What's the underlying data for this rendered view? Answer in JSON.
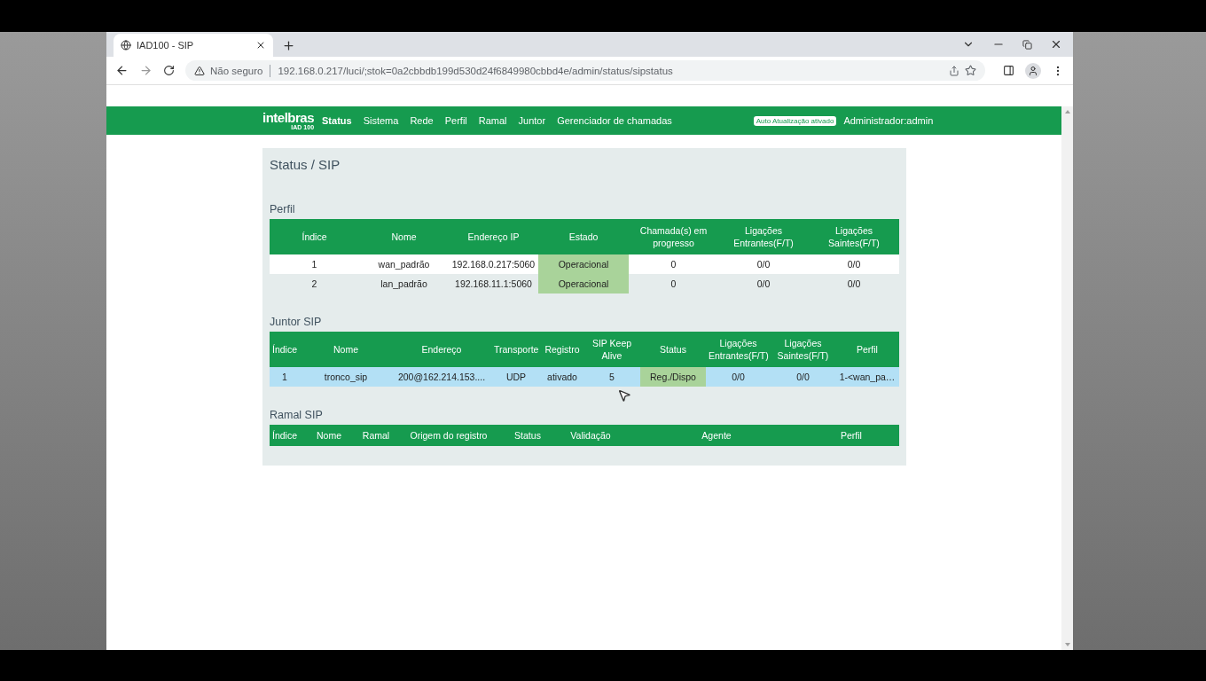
{
  "browser": {
    "tab": {
      "title": "IAD100 - SIP"
    },
    "address": {
      "security": "Não seguro",
      "url": "192.168.0.217/luci/;stok=0a2cbbdb199d530d24f6849980cbbd4e/admin/status/sipstatus"
    }
  },
  "nav": {
    "logo": "intelbras",
    "logo_sub": "IAD 100",
    "items": [
      {
        "label": "Status",
        "selected": true
      },
      {
        "label": "Sistema",
        "selected": false
      },
      {
        "label": "Rede",
        "selected": false
      },
      {
        "label": "Perfil",
        "selected": false
      },
      {
        "label": "Ramal",
        "selected": false
      },
      {
        "label": "Juntor",
        "selected": false
      },
      {
        "label": "Gerenciador de chamadas",
        "selected": false
      }
    ],
    "auto_update": "Auto Atualização ativado",
    "user": "Administrador:admin"
  },
  "page": {
    "title": "Status / SIP",
    "sections": [
      {
        "title": "Perfil",
        "columns": [
          {
            "label": "Índice",
            "kind": "text"
          },
          {
            "label": "Nome",
            "kind": "text"
          },
          {
            "label": "Endereço IP",
            "kind": "text"
          },
          {
            "label": "Estado",
            "kind": "status"
          },
          {
            "label": "Chamada(s) em progresso",
            "kind": "text"
          },
          {
            "label": "Ligações Entrantes(F/T)",
            "kind": "text"
          },
          {
            "label": "Ligações Saintes(F/T)",
            "kind": "text"
          }
        ],
        "rows": [
          {
            "cells": [
              "1",
              "wan_padrão",
              "192.168.0.217:5060",
              "Operacional",
              "0",
              "0/0",
              "0/0"
            ],
            "status_ok": true,
            "hovered": false
          },
          {
            "cells": [
              "2",
              "lan_padrão",
              "192.168.11.1:5060",
              "Operacional",
              "0",
              "0/0",
              "0/0"
            ],
            "status_ok": true,
            "hovered": false
          }
        ]
      },
      {
        "title": "Juntor SIP",
        "columns": [
          {
            "label": "Índice",
            "kind": "text"
          },
          {
            "label": "Nome",
            "kind": "text"
          },
          {
            "label": "Endereço",
            "kind": "text"
          },
          {
            "label": "Transporte",
            "kind": "text"
          },
          {
            "label": "Registro",
            "kind": "text"
          },
          {
            "label": "SIP Keep Alive",
            "kind": "text"
          },
          {
            "label": "Status",
            "kind": "status"
          },
          {
            "label": "Ligações Entrantes(F/T)",
            "kind": "text"
          },
          {
            "label": "Ligações Saintes(F/T)",
            "kind": "text"
          },
          {
            "label": "Perfil",
            "kind": "text"
          }
        ],
        "rows": [
          {
            "cells": [
              "1",
              "tronco_sip",
              "200@162.214.153....",
              "UDP",
              "ativado",
              "5",
              "Reg./Dispo",
              "0/0",
              "0/0",
              "1-<wan_pa…"
            ],
            "status_ok": true,
            "hovered": true
          }
        ]
      },
      {
        "title": "Ramal SIP",
        "columns": [
          {
            "label": "Índice"
          },
          {
            "label": "Nome"
          },
          {
            "label": "Ramal"
          },
          {
            "label": "Origem do registro"
          },
          {
            "label": "Status"
          },
          {
            "label": "Validação"
          },
          {
            "label": "Agente"
          },
          {
            "label": "Perfil"
          }
        ]
      }
    ]
  }
}
